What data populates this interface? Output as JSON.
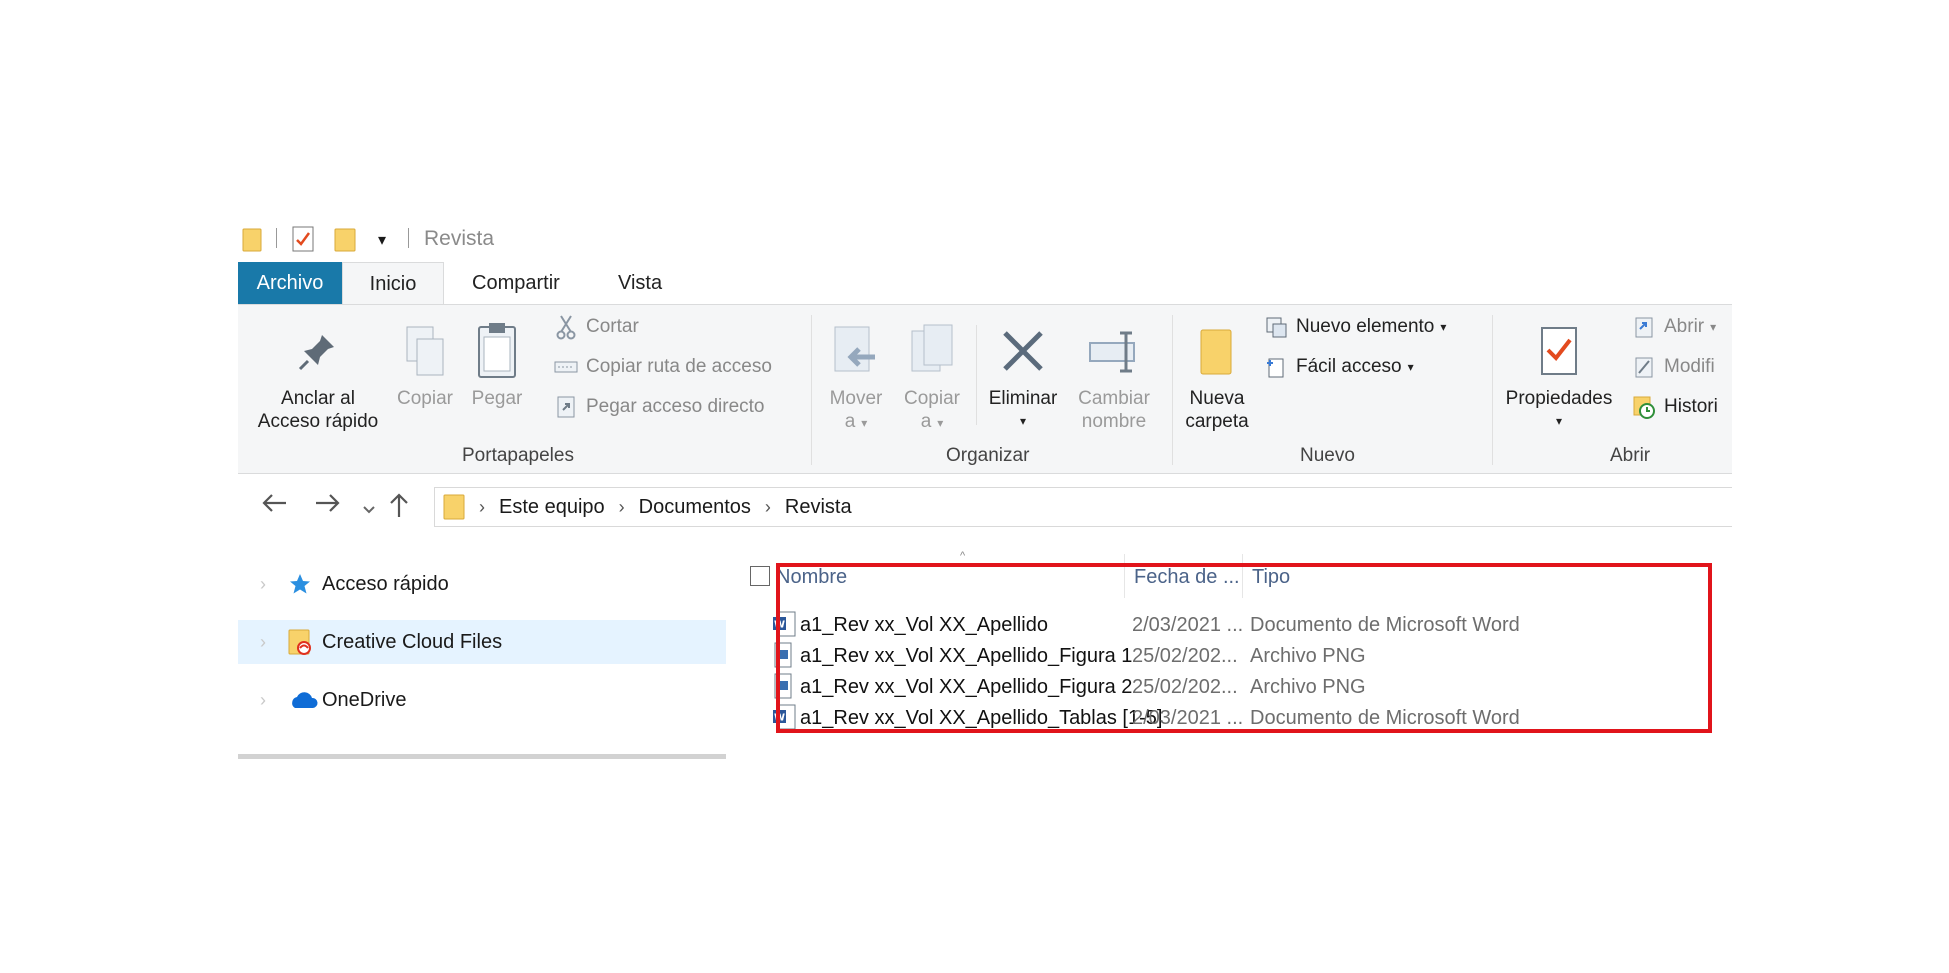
{
  "title_bar": {
    "title": "Revista",
    "dropdown_glyph": "▾"
  },
  "tabs": [
    {
      "label": "Archivo"
    },
    {
      "label": "Inicio"
    },
    {
      "label": "Compartir"
    },
    {
      "label": "Vista"
    }
  ],
  "ribbon": {
    "portapapeles": {
      "label": "Portapapeles",
      "pin_line1": "Anclar al",
      "pin_line2": "Acceso rápido",
      "copy": "Copiar",
      "paste": "Pegar",
      "cut": "Cortar",
      "copy_path": "Copiar ruta de acceso",
      "paste_shortcut": "Pegar acceso directo"
    },
    "organizar": {
      "label": "Organizar",
      "move_line1": "Mover",
      "move_line2": "a",
      "copyto_line1": "Copiar",
      "copyto_line2": "a",
      "delete": "Eliminar",
      "rename_line1": "Cambiar",
      "rename_line2": "nombre"
    },
    "nuevo": {
      "label": "Nuevo",
      "folder_line1": "Nueva",
      "folder_line2": "carpeta",
      "new_item": "Nuevo elemento",
      "easy_access": "Fácil acceso"
    },
    "abrir": {
      "label": "Abrir",
      "properties": "Propiedades",
      "open": "Abrir",
      "edit": "Modifi",
      "history": "Histori"
    }
  },
  "address": {
    "crumbs": [
      "Este equipo",
      "Documentos",
      "Revista"
    ],
    "separator": "›"
  },
  "nav_pane": {
    "items": [
      {
        "label": "Acceso rápido"
      },
      {
        "label": "Creative Cloud Files"
      },
      {
        "label": "OneDrive"
      }
    ]
  },
  "file_list": {
    "columns": {
      "name": "Nombre",
      "date": "Fecha de ...",
      "type": "Tipo"
    },
    "rows": [
      {
        "name": "a1_Rev xx_Vol XX_Apellido",
        "date": "2/03/2021 ...",
        "type": "Documento de Microsoft Word",
        "icon": "word-doc-icon"
      },
      {
        "name": "a1_Rev xx_Vol XX_Apellido_Figura 1",
        "date": "25/02/202...",
        "type": "Archivo PNG",
        "icon": "png-file-icon"
      },
      {
        "name": "a1_Rev xx_Vol XX_Apellido_Figura 2",
        "date": "25/02/202...",
        "type": "Archivo PNG",
        "icon": "png-file-icon"
      },
      {
        "name": "a1_Rev xx_Vol XX_Apellido_Tablas [1-5]",
        "date": "2/03/2021 ...",
        "type": "Documento de Microsoft Word",
        "icon": "word-doc-icon"
      }
    ]
  },
  "colors": {
    "file_tab": "#1979a9",
    "highlight": "#e1141b",
    "selection": "#e5f3ff",
    "folder": "#f8d26a"
  }
}
